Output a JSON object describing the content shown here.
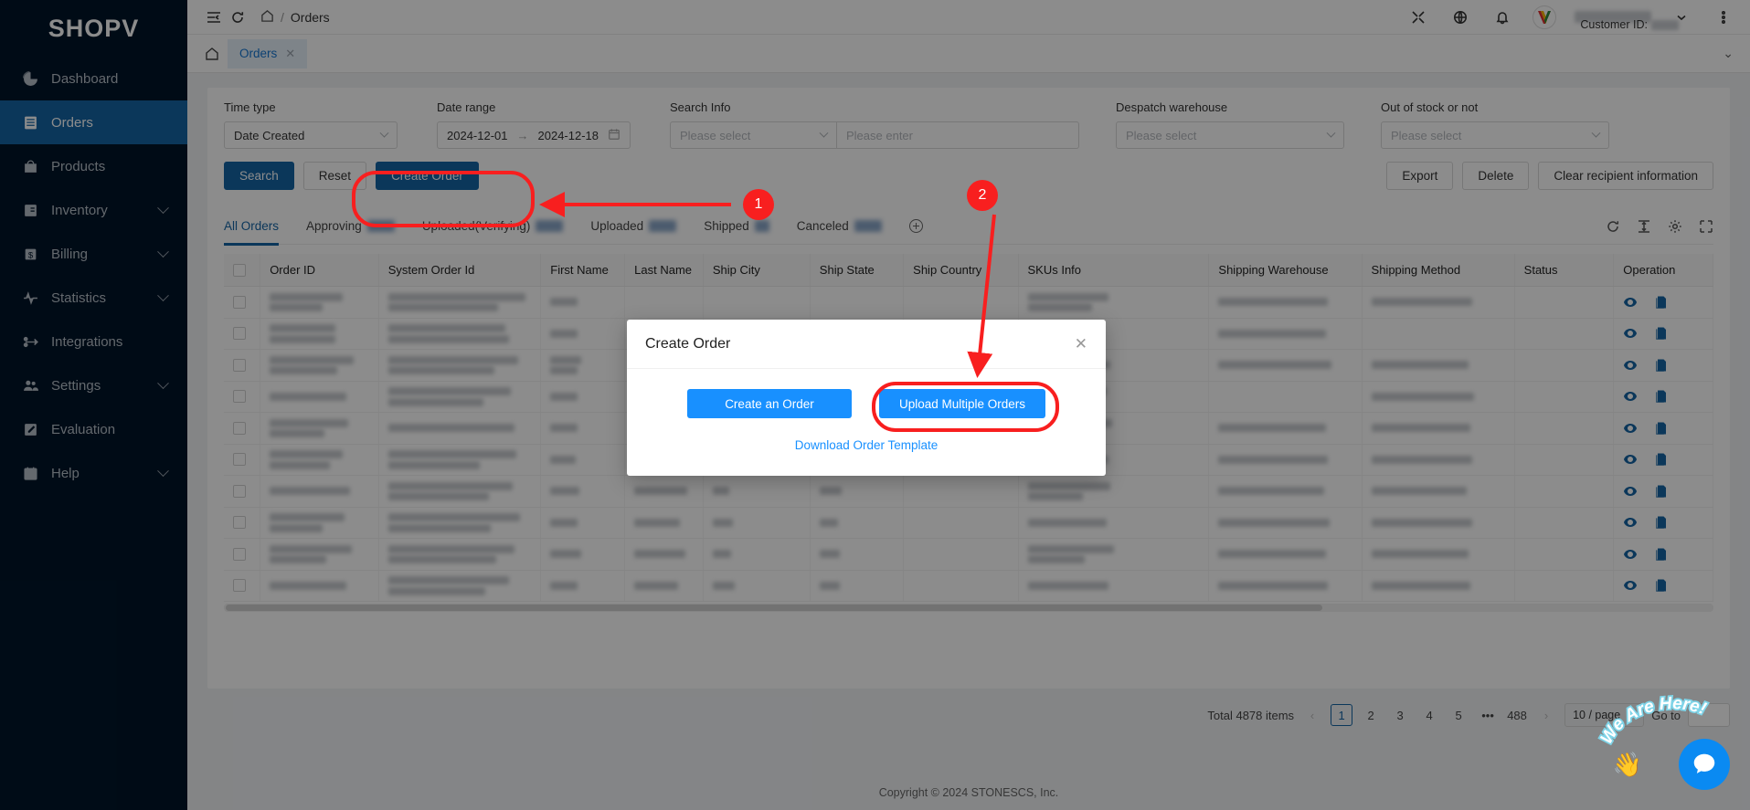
{
  "brand": {
    "name": "SHOPV"
  },
  "sidebar": {
    "items": [
      {
        "label": "Dashboard",
        "icon": "pie-chart-icon",
        "active": false,
        "expandable": false
      },
      {
        "label": "Orders",
        "icon": "list-icon",
        "active": true,
        "expandable": false
      },
      {
        "label": "Products",
        "icon": "bag-icon",
        "active": false,
        "expandable": false
      },
      {
        "label": "Inventory",
        "icon": "box-icon",
        "active": false,
        "expandable": true
      },
      {
        "label": "Billing",
        "icon": "dollar-icon",
        "active": false,
        "expandable": true
      },
      {
        "label": "Statistics",
        "icon": "pulse-icon",
        "active": false,
        "expandable": true
      },
      {
        "label": "Integrations",
        "icon": "usb-icon",
        "active": false,
        "expandable": false
      },
      {
        "label": "Settings",
        "icon": "users-icon",
        "active": false,
        "expandable": true
      },
      {
        "label": "Evaluation",
        "icon": "edit-square-icon",
        "active": false,
        "expandable": false
      },
      {
        "label": "Help",
        "icon": "calendar-icon",
        "active": false,
        "expandable": true
      }
    ]
  },
  "topbar": {
    "breadcrumb_home": "home-icon",
    "breadcrumb_separator": "/",
    "breadcrumb_current": "Orders",
    "customer_id_label": "Customer ID:",
    "icons": [
      "collapse-icon",
      "refresh-icon",
      "fullscreen-icon",
      "globe-icon",
      "bell-icon",
      "more-icon"
    ]
  },
  "page_tabs": {
    "home_icon": "home-icon",
    "tabs": [
      {
        "label": "Orders",
        "closable": true,
        "active": true
      }
    ]
  },
  "filters": {
    "time_type": {
      "label": "Time type",
      "value": "Date Created"
    },
    "date_range": {
      "label": "Date range",
      "start": "2024-12-01",
      "end": "2024-12-18",
      "arrow": "→"
    },
    "search_info": {
      "label": "Search Info",
      "select_placeholder": "Please select",
      "input_placeholder": "Please enter"
    },
    "despatch_warehouse": {
      "label": "Despatch warehouse",
      "placeholder": "Please select"
    },
    "out_of_stock": {
      "label": "Out of stock or not",
      "placeholder": "Please select"
    }
  },
  "actions": {
    "search": "Search",
    "reset": "Reset",
    "create_order": "Create Order",
    "export": "Export",
    "delete": "Delete",
    "clear_recipient": "Clear recipient information"
  },
  "status_tabs": [
    {
      "label": "All Orders",
      "active": true,
      "count_redacted": false
    },
    {
      "label": "Approving",
      "active": false,
      "count_redacted": true
    },
    {
      "label": "Uploaded(Verifying)",
      "active": false,
      "count_redacted": true
    },
    {
      "label": "Uploaded",
      "active": false,
      "count_redacted": true
    },
    {
      "label": "Shipped",
      "active": false,
      "count_redacted": true,
      "count_small": true
    },
    {
      "label": "Canceled",
      "active": false,
      "count_redacted": true
    }
  ],
  "table_tools": [
    "refresh-icon",
    "row-height-icon",
    "settings-gear-icon",
    "fullscreen-icon"
  ],
  "table": {
    "columns": [
      "Order ID",
      "System Order Id",
      "First Name",
      "Last Name",
      "Ship City",
      "Ship State",
      "Ship Country",
      "SKUs Info",
      "Shipping Warehouse",
      "Shipping Method",
      "Status",
      "Operation"
    ],
    "row_count": 10,
    "redacted": true,
    "operation_icons": [
      "eye-icon",
      "copy-icon"
    ]
  },
  "pagination": {
    "total_text": "Total 4878 items",
    "prev": "‹",
    "pages": [
      "1",
      "2",
      "3",
      "4",
      "5",
      "•••",
      "488"
    ],
    "current": "1",
    "next": "›",
    "page_size": "10 / page",
    "goto_label": "Go to",
    "goto_value": ""
  },
  "footer": {
    "copyright": "Copyright © 2024 STONESCS, Inc."
  },
  "modal": {
    "title": "Create Order",
    "close": "✕",
    "create_single": "Create an Order",
    "upload_multiple": "Upload Multiple Orders",
    "download_template": "Download Order Template"
  },
  "annotations": {
    "marker_1": "1",
    "marker_2": "2",
    "highlight_color": "#f81f1f"
  },
  "chat_widget": {
    "label": "We Are Here!",
    "icon": "chat-bubble-icon",
    "wave": "👋"
  }
}
